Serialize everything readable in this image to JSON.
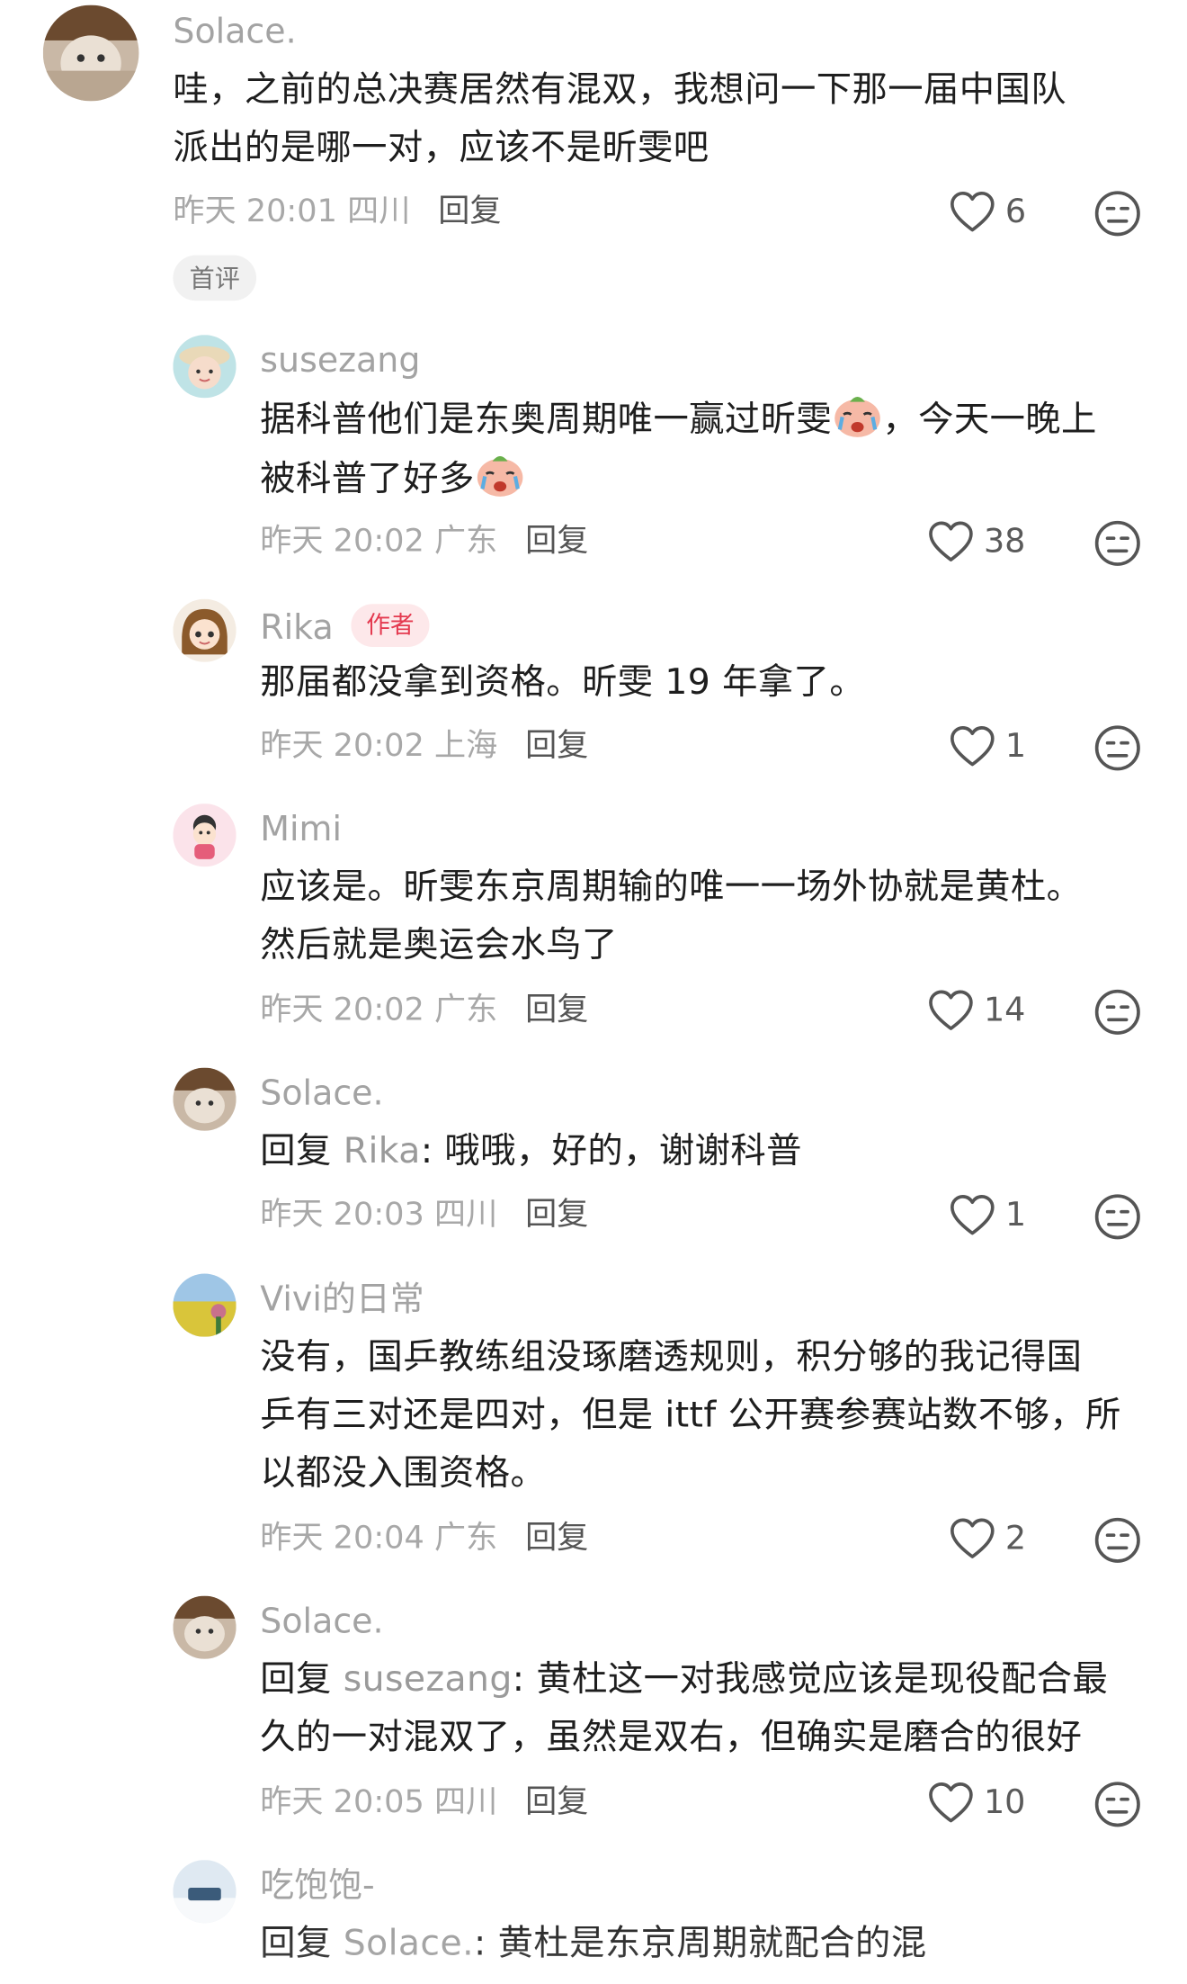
{
  "comments": [
    {
      "username": "Solace.",
      "lines": [
        "哇，之前的总决赛居然有混双，我想问一下那一届中国队",
        "派出的是哪一对，应该不是昕雯吧"
      ],
      "time": "昨天 20:01 四川",
      "reply_label": "回复",
      "likes": "6",
      "badge": "首评"
    },
    {
      "username": "susezang",
      "lines": [
        "据科普他们是东奥周期唯一赢过昕雯",
        "，今天一晚上",
        "被科普了好多"
      ],
      "emoji": "crying-emoji-icon",
      "time": "昨天 20:02 广东",
      "reply_label": "回复",
      "likes": "38"
    },
    {
      "username": "Rika",
      "author_tag": "作者",
      "lines": [
        "那届都没拿到资格。昕雯 19 年拿了。"
      ],
      "time": "昨天 20:02 上海",
      "reply_label": "回复",
      "likes": "1"
    },
    {
      "username": "Mimi",
      "lines": [
        "应该是。昕雯东京周期输的唯一一场外协就是黄杜。",
        "然后就是奥运会水鸟了"
      ],
      "time": "昨天 20:02 广东",
      "reply_label": "回复",
      "likes": "14"
    },
    {
      "username": "Solace.",
      "reply_prefix": "回复 ",
      "reply_to": "Rika",
      "lines": [
        ": 哦哦，好的，谢谢科普"
      ],
      "time": "昨天 20:03 四川",
      "reply_label": "回复",
      "likes": "1"
    },
    {
      "username": "Vivi的日常",
      "lines": [
        "没有，国乒教练组没琢磨透规则，积分够的我记得国",
        "乒有三对还是四对，但是 ittf 公开赛参赛站数不够，所",
        "以都没入围资格。"
      ],
      "time": "昨天 20:04 广东",
      "reply_label": "回复",
      "likes": "2"
    },
    {
      "username": "Solace.",
      "reply_prefix": "回复 ",
      "reply_to": "susezang",
      "lines": [
        ": 黄杜这一对我感觉应该是现役配合最",
        "久的一对混双了，虽然是双右，但确实是磨合的很好"
      ],
      "time": "昨天 20:05 四川",
      "reply_label": "回复",
      "likes": "10"
    },
    {
      "username": "吃饱饱-",
      "reply_prefix": "回复 ",
      "reply_to": "Solace.",
      "lines": [
        ": 黄杜是东京周期就配合的混"
      ]
    }
  ],
  "colors": {
    "username": "#a3a3a3",
    "body": "#1e1e1e",
    "meta": "#a8a8a8",
    "author_tag_bg": "#fde8ea",
    "author_tag_text": "#e4394f"
  },
  "icons": {
    "like": "heart-outline-icon",
    "react": "meh-face-icon"
  }
}
